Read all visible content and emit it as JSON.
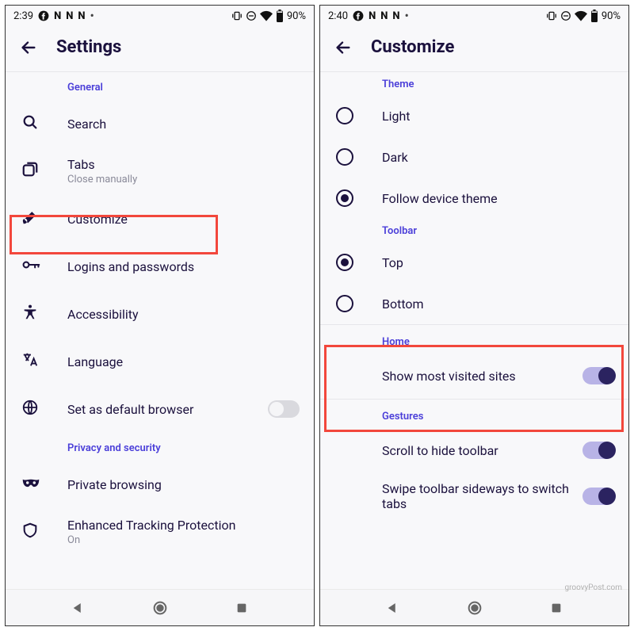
{
  "left": {
    "statusbar": {
      "time": "2:39",
      "battery_pct": "90%"
    },
    "header": {
      "title": "Settings"
    },
    "sections": {
      "general": {
        "label": "General"
      },
      "privacy": {
        "label": "Privacy and security"
      }
    },
    "items": {
      "search": {
        "label": "Search"
      },
      "tabs": {
        "label": "Tabs",
        "sub": "Close manually"
      },
      "customize": {
        "label": "Customize"
      },
      "logins": {
        "label": "Logins and passwords"
      },
      "accessibility": {
        "label": "Accessibility"
      },
      "language": {
        "label": "Language"
      },
      "default_browser": {
        "label": "Set as default browser"
      },
      "private_browsing": {
        "label": "Private browsing"
      },
      "etp": {
        "label": "Enhanced Tracking Protection",
        "sub": "On"
      }
    }
  },
  "right": {
    "statusbar": {
      "time": "2:40",
      "battery_pct": "90%"
    },
    "header": {
      "title": "Customize"
    },
    "theme": {
      "label": "Theme",
      "options": {
        "light": "Light",
        "dark": "Dark",
        "follow": "Follow device theme"
      },
      "selected": "follow"
    },
    "toolbar": {
      "label": "Toolbar",
      "options": {
        "top": "Top",
        "bottom": "Bottom"
      },
      "selected": "top"
    },
    "home": {
      "label": "Home",
      "most_visited": "Show most visited sites"
    },
    "gestures": {
      "label": "Gestures",
      "scroll_hide": "Scroll to hide toolbar",
      "swipe_switch": "Swipe toolbar sideways to switch tabs"
    }
  },
  "watermark": "groovyPost.com"
}
